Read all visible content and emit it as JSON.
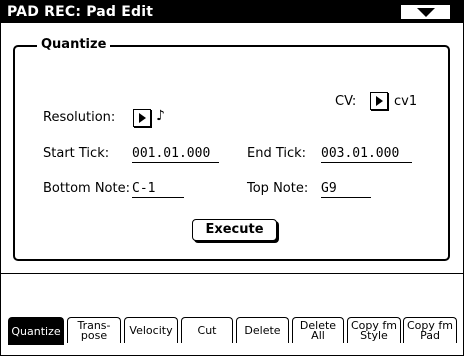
{
  "header": {
    "title": "PAD REC: Pad Edit",
    "menu_icon": "triangle-down-icon"
  },
  "quantize": {
    "title": "Quantize",
    "cv_label": "CV:",
    "cv_value": "cv1",
    "resolution_label": "Resolution:",
    "resolution_value": "♪",
    "start_tick_label": "Start Tick:",
    "start_tick_value": "001.01.000",
    "end_tick_label": "End Tick:",
    "end_tick_value": "003.01.000",
    "bottom_note_label": "Bottom Note:",
    "bottom_note_value": "C-1",
    "top_note_label": "Top Note:",
    "top_note_value": "G9",
    "execute_label": "Execute"
  },
  "tabs": [
    {
      "label": "Quantize",
      "active": true
    },
    {
      "label": "Trans-\npose"
    },
    {
      "label": "Velocity"
    },
    {
      "label": "Cut"
    },
    {
      "label": "Delete"
    },
    {
      "label": "Delete\nAll"
    },
    {
      "label": "Copy fm\nStyle"
    },
    {
      "label": "Copy fm\nPad"
    }
  ]
}
